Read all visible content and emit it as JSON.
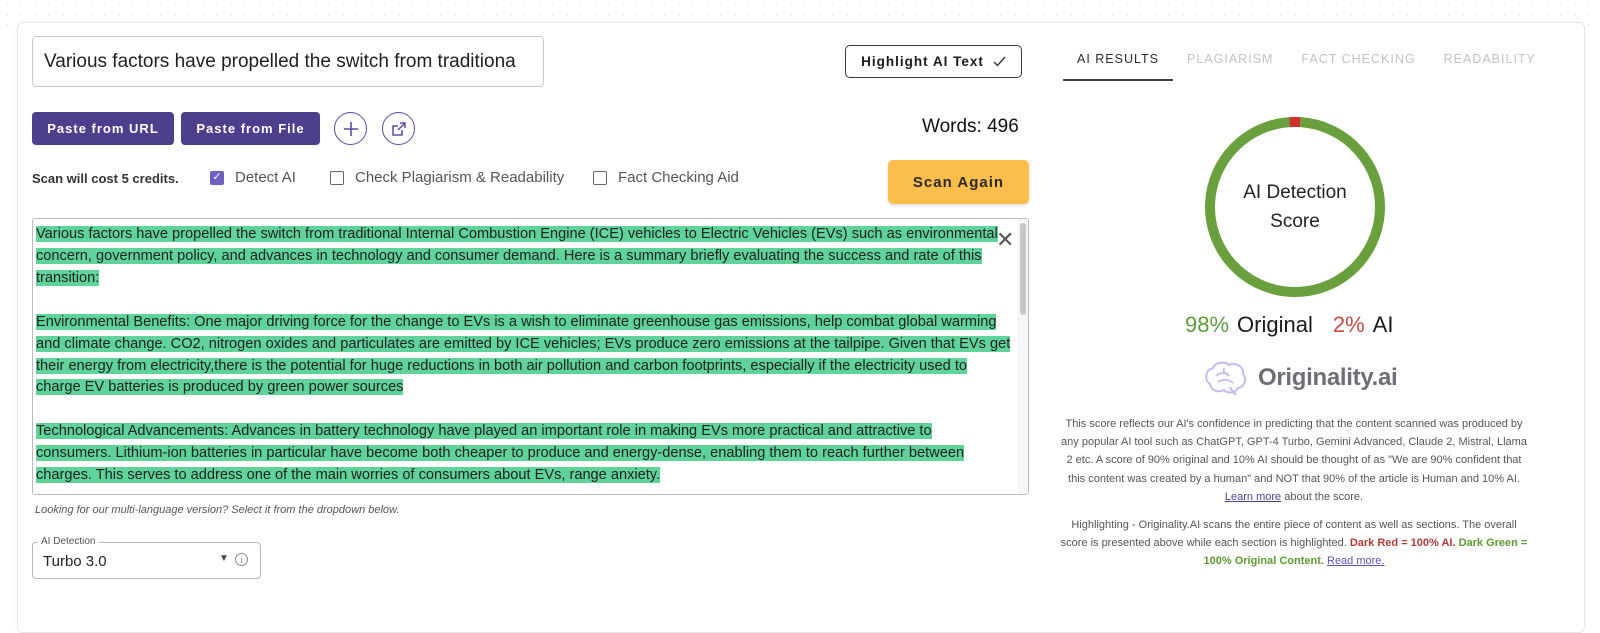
{
  "title_input": {
    "value": "Various factors have propelled the switch from traditiona"
  },
  "toolbar": {
    "highlight_label": "Highlight AI Text",
    "paste_url_label": "Paste from URL",
    "paste_file_label": "Paste from File",
    "add_icon": "plus-icon",
    "share_icon": "share-icon",
    "words_label": "Words: 496"
  },
  "options": {
    "cost_text": "Scan will cost 5 credits.",
    "detect_ai_label": "Detect AI",
    "detect_ai_checked": true,
    "plagiarism_label": "Check Plagiarism & Readability",
    "plagiarism_checked": false,
    "fact_label": "Fact Checking Aid",
    "fact_checked": false,
    "scan_label": "Scan Again"
  },
  "editor": {
    "paragraphs": [
      "Various factors have propelled the switch from traditional Internal Combustion Engine (ICE) vehicles to Electric Vehicles (EVs) such as environmental concern, government policy, and advances in technology and consumer demand. Here is a summary briefly evaluating the success and rate of this transition:",
      "Environmental Benefits: One major driving force for the change to EVs is a wish to eliminate greenhouse gas emissions, help combat global warming and climate change. CO2, nitrogen oxides and particulates are emitted by ICE vehicles; EVs produce zero emissions at the tailpipe. Given that EVs get their energy from electricity,there is the potential for huge reductions in both air pollution and carbon footprints, especially if the electricity used to charge EV batteries is produced by green power sources",
      "Technological Advancements: Advances in battery technology have played an important role in making EVs more practical and attractive to consumers. Lithium-ion batteries in particular have become both cheaper to produce and energy-dense, enabling them to reach further between charges. This serves to address one of the main worries of consumers about EVs, range anxiety."
    ],
    "highlight_color": "#5fd39a",
    "close_icon": "close-icon"
  },
  "hint": "Looking for our multi-language version? Select it from the dropdown below.",
  "model_select": {
    "legend": "AI Detection",
    "value": "Turbo 3.0"
  },
  "tabs": [
    {
      "label": "AI RESULTS",
      "active": true
    },
    {
      "label": "PLAGIARISM",
      "active": false
    },
    {
      "label": "FACT CHECKING",
      "active": false
    },
    {
      "label": "READABILITY",
      "active": false
    }
  ],
  "result": {
    "donut_line1": "AI Detection",
    "donut_line2": "Score",
    "original_pct": "98%",
    "original_label": "Original",
    "ai_pct": "2%",
    "ai_label": "AI",
    "original_fraction": 0.98,
    "ai_fraction": 0.02,
    "original_color": "#6a9f3d",
    "ai_color": "#c9322f"
  },
  "brand": {
    "name": "Originality.ai",
    "icon": "brain-logo-icon"
  },
  "description": {
    "text": "This score reflects our AI's confidence in predicting that the content scanned was produced by any popular AI tool such as ChatGPT, GPT-4 Turbo, Gemini Advanced, Claude 2, Mistral, Llama 2 etc. A score of 90% original and 10% AI should be thought of as \"We are 90% confident that this content was created by a human\" and NOT that 90% of the article is Human and 10% AI.",
    "link": "Learn more",
    "tail": "about the score."
  },
  "highlight_note": {
    "text": "Highlighting - Originality.AI scans the entire piece of content as well as sections. The overall score is presented above while each section is highlighted.",
    "red": "Dark Red = 100% AI.",
    "green": "Dark Green = 100% Original Content.",
    "link": "Read more."
  }
}
